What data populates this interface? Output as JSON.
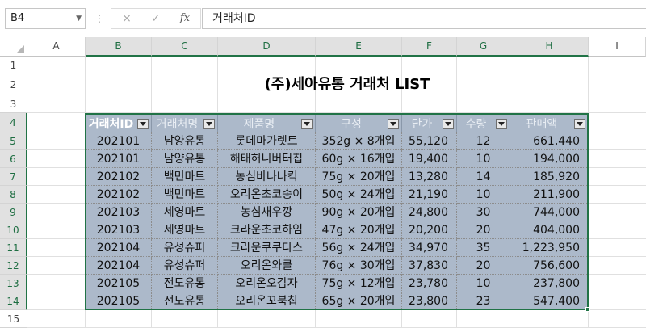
{
  "formula_bar": {
    "name_box": "B4",
    "cancel_icon": "×",
    "enter_icon": "✓",
    "function_icon": "fx",
    "formula_value": "거래처ID"
  },
  "columns": [
    "A",
    "B",
    "C",
    "D",
    "E",
    "F",
    "G",
    "H",
    "I"
  ],
  "rows": [
    "1",
    "2",
    "3",
    "4",
    "5",
    "6",
    "7",
    "8",
    "9",
    "10",
    "11",
    "12",
    "13",
    "14",
    "15"
  ],
  "title": "(주)세아유통 거래처 LIST",
  "table": {
    "headers": [
      "거래처ID",
      "거래처명",
      "제품명",
      "구성",
      "단가",
      "수량",
      "판매액"
    ],
    "rows": [
      [
        "202101",
        "남양유통",
        "롯데마가렛트",
        "352g × 8개입",
        "55,120",
        "12",
        "661,440"
      ],
      [
        "202101",
        "남양유통",
        "해태허니버터칩",
        "60g × 16개입",
        "19,400",
        "10",
        "194,000"
      ],
      [
        "202102",
        "백민마트",
        "농심바나나킥",
        "75g × 20개입",
        "13,280",
        "14",
        "185,920"
      ],
      [
        "202102",
        "백민마트",
        "오리온초코송이",
        "50g × 24개입",
        "21,190",
        "10",
        "211,900"
      ],
      [
        "202103",
        "세영마트",
        "농심새우깡",
        "90g × 20개입",
        "24,800",
        "30",
        "744,000"
      ],
      [
        "202103",
        "세영마트",
        "크라운초코하임",
        "47g × 20개입",
        "20,200",
        "20",
        "404,000"
      ],
      [
        "202104",
        "유성슈퍼",
        "크라운쿠쿠다스",
        "56g × 24개입",
        "34,970",
        "35",
        "1,223,950"
      ],
      [
        "202104",
        "유성슈퍼",
        "오리온와클",
        "76g × 30개입",
        "37,830",
        "20",
        "756,600"
      ],
      [
        "202105",
        "전도유통",
        "오리온오감자",
        "75g × 12개입",
        "23,780",
        "10",
        "237,800"
      ],
      [
        "202105",
        "전도유통",
        "오리온꼬북칩",
        "65g × 20개입",
        "23,800",
        "23",
        "547,400"
      ]
    ]
  },
  "colors": {
    "table_fill": "#acb9ca",
    "header_text": "#e8edf3",
    "selection": "#217346"
  }
}
